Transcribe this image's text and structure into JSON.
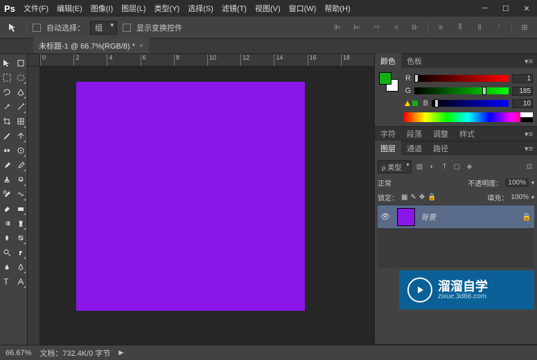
{
  "app": {
    "logo": "Ps"
  },
  "menu": [
    "文件(F)",
    "编辑(E)",
    "图像(I)",
    "图层(L)",
    "类型(Y)",
    "选择(S)",
    "滤镜(T)",
    "视图(V)",
    "窗口(W)",
    "帮助(H)"
  ],
  "options": {
    "auto_select": "自动选择：",
    "group": "组",
    "show_transform": "显示变换控件"
  },
  "tab": {
    "title": "未标题-1 @ 66.7%(RGB/8) *"
  },
  "ruler": [
    "0",
    "2",
    "4",
    "6",
    "8",
    "10",
    "12",
    "14",
    "16",
    "18"
  ],
  "canvas": {
    "fill": "#8a16ea"
  },
  "panels": {
    "color": {
      "tab1": "颜色",
      "tab2": "色板",
      "swatch1": "#12b012",
      "r_label": "R",
      "r_val": "1",
      "g_label": "G",
      "g_val": "185",
      "b_label": "B",
      "b_val": "10"
    },
    "char": {
      "tab1": "字符",
      "tab2": "段落",
      "tab3": "调整",
      "tab4": "样式"
    },
    "layers": {
      "tab1": "图层",
      "tab2": "通道",
      "tab3": "路径",
      "kind": "ρ 类型",
      "blend": "正常",
      "opacity_label": "不透明度：",
      "opacity": "100%",
      "lock_label": "锁定：",
      "fill_label": "填充：",
      "fill": "100%",
      "layer_name": "背景"
    }
  },
  "watermark": {
    "line1": "溜溜自学",
    "line2": "zixue.3d66.com"
  },
  "status": {
    "zoom": "66.67%",
    "doc": "文档：732.4K/0 字节"
  }
}
